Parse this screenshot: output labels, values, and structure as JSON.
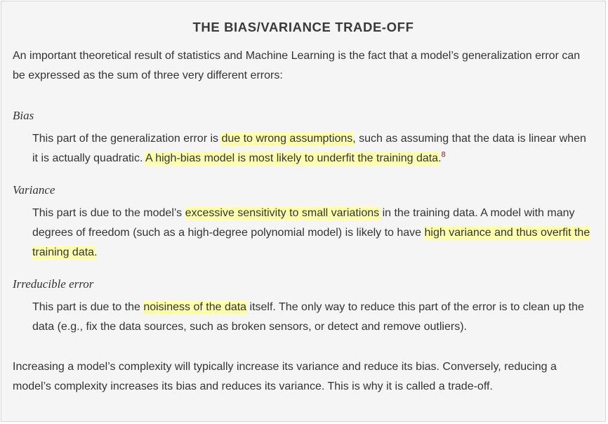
{
  "title": "THE BIAS/VARIANCE TRADE-OFF",
  "intro": "An important theoretical result of statistics and Machine Learning is the fact that a model’s generalization error can be expressed as the sum of three very different errors:",
  "bias": {
    "term": "Bias",
    "t1": "This part of the generalization error is ",
    "h1": "due to wrong assumptions",
    "t2": ", such as assuming that the data is linear when it is actually quadratic. ",
    "h2": "A high-bias model is most likely to underfit the training data",
    "t3": ".",
    "footnote": "8"
  },
  "variance": {
    "term": "Variance",
    "t1": "This part is due to the model’s ",
    "h1": "excessive sensitivity to small variations",
    "t2": " in the training data. A model with many degrees of freedom (such as a high-degree polynomial model) is likely to have ",
    "h2": "high variance and thus overfit the training data",
    "t3": "."
  },
  "irreducible": {
    "term": "Irreducible error",
    "t1": "This part is due to the ",
    "h1": "noisiness of the data",
    "t2": " itself. The only way to reduce this part of the error is to clean up the data (e.g., fix the data sources, such as broken sensors, or detect and remove outliers)."
  },
  "closing": "Increasing a model’s complexity will typically increase its variance and reduce its bias. Conversely, reducing a model’s complexity increases its bias and reduces its variance. This is why it is called a trade-off.",
  "colors": {
    "highlight": "#ffffb0",
    "background": "#f5f5f5",
    "footnote": "#8b1a1a"
  }
}
